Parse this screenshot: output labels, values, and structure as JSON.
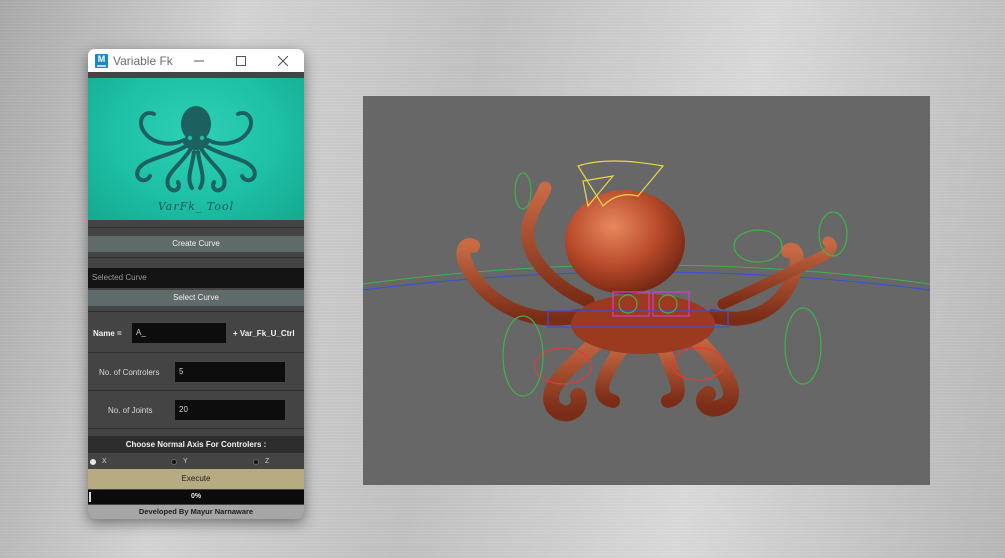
{
  "window": {
    "title": "Variable Fk",
    "app_icon_letter": "M",
    "banner_label": "VarFk_ Tool",
    "buttons": {
      "minimize": "—",
      "maximize": "☐",
      "close": "✕"
    }
  },
  "tool": {
    "create_curve_label": "Create Curve",
    "selected_curve_placeholder": "Selected Curve",
    "select_curve_label": "Select Curve",
    "name_label": "Name =",
    "name_value": "A_",
    "name_suffix": "+ Var_Fk_U_Ctrl",
    "controllers_label": "No. of Controlers",
    "controllers_value": "5",
    "joints_label": "No. of Joints",
    "joints_value": "20",
    "axis_header": "Choose Normal Axis For Controlers :",
    "axes": [
      {
        "label": "X",
        "selected": true
      },
      {
        "label": "Y",
        "selected": false
      },
      {
        "label": "Z",
        "selected": false
      }
    ],
    "execute_label": "Execute",
    "progress_text": "0%",
    "progress_value": 0,
    "footer": "Developed By Mayur Narnaware"
  },
  "colors": {
    "banner": "#1dbfa5",
    "octopus_logo": "#1c6060",
    "button": "#5e6b6a",
    "execute": "#b7ab82",
    "viewport": "#676767",
    "octopus_body": "#b54a2a",
    "ctrl_yellow": "#e8d84a",
    "ctrl_green": "#3fb34a",
    "ctrl_red": "#e23a36",
    "ctrl_magenta": "#d63cc9",
    "ctrl_blue": "#3a4fd6"
  }
}
